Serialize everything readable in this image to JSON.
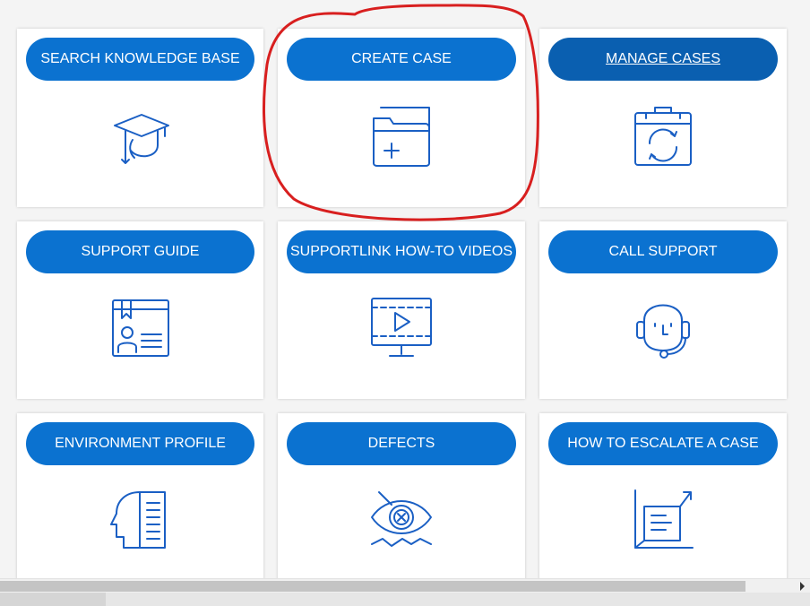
{
  "theme": {
    "accent": "#0b72d0",
    "accent_active": "#0a5fb0",
    "icon_color": "#1a5fc4",
    "annotation_color": "#d81f1f"
  },
  "tiles": [
    {
      "label": "SEARCH KNOWLEDGE BASE",
      "icon": "graduation-cap-icon"
    },
    {
      "label": "CREATE CASE",
      "icon": "folder-plus-icon",
      "highlighted": true
    },
    {
      "label": "MANAGE CASES",
      "icon": "briefcase-sync-icon",
      "active": true
    },
    {
      "label": "SUPPORT GUIDE",
      "icon": "guide-book-icon"
    },
    {
      "label": "SUPPORTLINK HOW-TO VIDEOS",
      "icon": "video-monitor-icon"
    },
    {
      "label": "CALL SUPPORT",
      "icon": "headset-icon"
    },
    {
      "label": "ENVIRONMENT PROFILE",
      "icon": "head-profile-icon"
    },
    {
      "label": "DEFECTS",
      "icon": "eye-defect-icon"
    },
    {
      "label": "HOW TO ESCALATE A CASE",
      "icon": "escalate-chart-icon"
    }
  ]
}
